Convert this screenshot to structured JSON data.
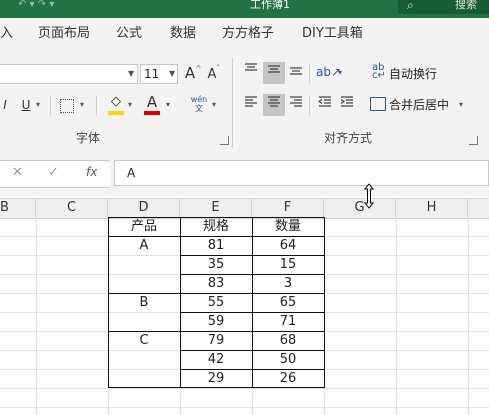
{
  "window": {
    "title": "工作薄1",
    "search_label": "搜索",
    "undo_glyphs": "↶ ▾  ↷ ▾"
  },
  "tabs": [
    {
      "label": "入"
    },
    {
      "label": "页面布局"
    },
    {
      "label": "公式"
    },
    {
      "label": "数据"
    },
    {
      "label": "方方格子"
    },
    {
      "label": "DIY工具箱"
    }
  ],
  "ribbon": {
    "font_size": "11",
    "grow_font": "A",
    "shrink_font": "A",
    "underline": "U",
    "font_color_letter": "A",
    "phonetic": "wén\n文",
    "wrap_text_label": "自动换行",
    "merge_center_label": "合并后居中",
    "font_group_label": "字体",
    "align_group_label": "对齐方式",
    "fill_color": "#ffd400",
    "font_color": "#e00000"
  },
  "formula_bar": {
    "cancel": "✕",
    "confirm": "✓",
    "fx": "fx",
    "value": "A"
  },
  "columns": [
    "B",
    "C",
    "D",
    "E",
    "F",
    "G",
    "H"
  ],
  "table": {
    "headers": [
      "产品",
      "规格",
      "数量"
    ],
    "rows": [
      [
        "A",
        "81",
        "64"
      ],
      [
        "",
        "35",
        "15"
      ],
      [
        "",
        "83",
        "3"
      ],
      [
        "B",
        "55",
        "65"
      ],
      [
        "",
        "59",
        "71"
      ],
      [
        "C",
        "79",
        "68"
      ],
      [
        "",
        "42",
        "50"
      ],
      [
        "",
        "29",
        "26"
      ]
    ]
  },
  "colors": {
    "brand": "#217346",
    "ribbon_bg": "#f3f3f3",
    "header_bg": "#efefef"
  }
}
